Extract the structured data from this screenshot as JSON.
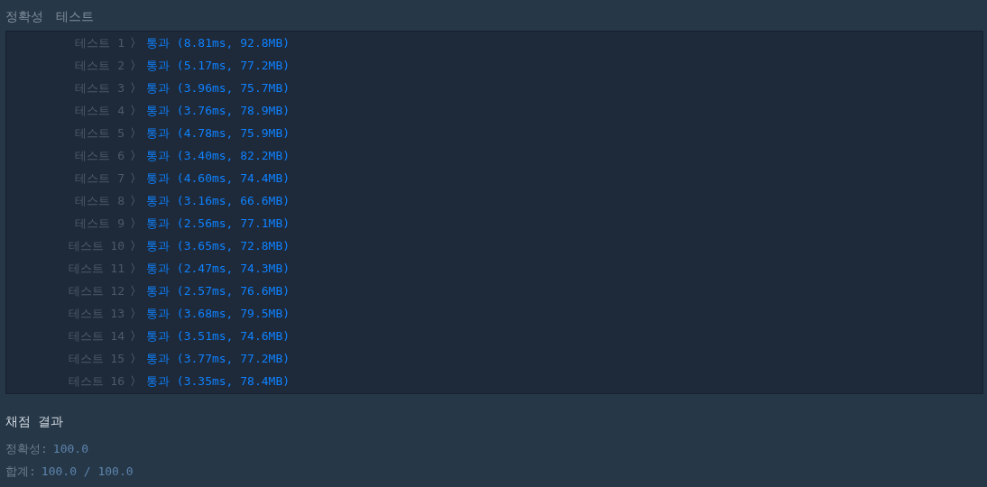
{
  "header": {
    "title": "정확성",
    "subtitle": "테스트"
  },
  "tests": [
    {
      "label": "테스트 1",
      "separator": "〉",
      "passed": true,
      "result": "통과 (8.81ms, 92.8MB)"
    },
    {
      "label": "테스트 2",
      "separator": "〉",
      "passed": true,
      "result": "통과 (5.17ms, 77.2MB)"
    },
    {
      "label": "테스트 3",
      "separator": "〉",
      "passed": true,
      "result": "통과 (3.96ms, 75.7MB)"
    },
    {
      "label": "테스트 4",
      "separator": "〉",
      "passed": true,
      "result": "통과 (3.76ms, 78.9MB)"
    },
    {
      "label": "테스트 5",
      "separator": "〉",
      "passed": true,
      "result": "통과 (4.78ms, 75.9MB)"
    },
    {
      "label": "테스트 6",
      "separator": "〉",
      "passed": true,
      "result": "통과 (3.40ms, 82.2MB)"
    },
    {
      "label": "테스트 7",
      "separator": "〉",
      "passed": true,
      "result": "통과 (4.60ms, 74.4MB)"
    },
    {
      "label": "테스트 8",
      "separator": "〉",
      "passed": true,
      "result": "통과 (3.16ms, 66.6MB)"
    },
    {
      "label": "테스트 9",
      "separator": "〉",
      "passed": true,
      "result": "통과 (2.56ms, 77.1MB)"
    },
    {
      "label": "테스트 10",
      "separator": "〉",
      "passed": true,
      "result": "통과 (3.65ms, 72.8MB)"
    },
    {
      "label": "테스트 11",
      "separator": "〉",
      "passed": true,
      "result": "통과 (2.47ms, 74.3MB)"
    },
    {
      "label": "테스트 12",
      "separator": "〉",
      "passed": true,
      "result": "통과 (2.57ms, 76.6MB)"
    },
    {
      "label": "테스트 13",
      "separator": "〉",
      "passed": true,
      "result": "통과 (3.68ms, 79.5MB)"
    },
    {
      "label": "테스트 14",
      "separator": "〉",
      "passed": true,
      "result": "통과 (3.51ms, 74.6MB)"
    },
    {
      "label": "테스트 15",
      "separator": "〉",
      "passed": true,
      "result": "통과 (3.77ms, 77.2MB)"
    },
    {
      "label": "테스트 16",
      "separator": "〉",
      "passed": true,
      "result": "통과 (3.35ms, 78.4MB)"
    }
  ],
  "summary": {
    "title": "채점 결과",
    "lines": [
      {
        "label": "정확성:",
        "value": "100.0"
      },
      {
        "label": "합계:",
        "value": "100.0 / 100.0"
      }
    ]
  }
}
